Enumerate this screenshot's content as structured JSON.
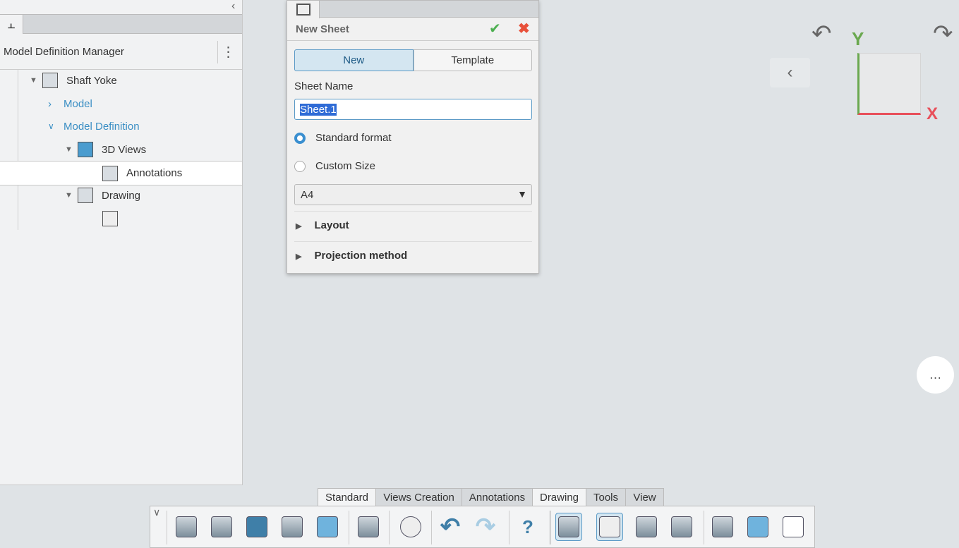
{
  "left_panel": {
    "collapse_icon": "chevron-left-icon",
    "tab_icon": "tree-icon",
    "title": "Model Definition Manager",
    "menu_icon": "kebab-icon",
    "tree": [
      {
        "label": "Shaft Yoke",
        "expanded": true
      },
      {
        "label": "Model",
        "expanded": false
      },
      {
        "label": "Model Definition",
        "expanded": true
      },
      {
        "label": "3D Views",
        "expanded": true
      },
      {
        "label": "Annotations",
        "selected": true
      },
      {
        "label": "Drawing",
        "expanded": true
      },
      {
        "label": ""
      }
    ]
  },
  "dialog": {
    "title": "New Sheet",
    "ok_icon": "check-icon",
    "cancel_icon": "close-icon",
    "mode_new": "New",
    "mode_template": "Template",
    "selected_mode": "New",
    "sheet_name_label": "Sheet Name",
    "sheet_name_value": "Sheet.1",
    "standard_format": "Standard format",
    "custom_size": "Custom Size",
    "selected_format": "Standard format",
    "format_value": "A4",
    "sections": [
      "Layout",
      "Projection method"
    ]
  },
  "compass": {
    "y_label": "Y",
    "x_label": "X",
    "y_color": "#6aa84f",
    "x_color": "#e8505b"
  },
  "toolbar": {
    "tabs": [
      "Standard",
      "Views Creation",
      "Annotations",
      "Drawing",
      "Tools",
      "View"
    ],
    "active_tab": "Drawing",
    "buttons": [
      "open",
      "save-as",
      "save",
      "save-to-database",
      "update",
      "compare",
      "settings",
      "undo",
      "redo",
      "help",
      "generate-views",
      "new-sheet",
      "sheet-background",
      "save-sheet",
      "views-from-3d",
      "3d-view",
      "views-layout"
    ]
  }
}
